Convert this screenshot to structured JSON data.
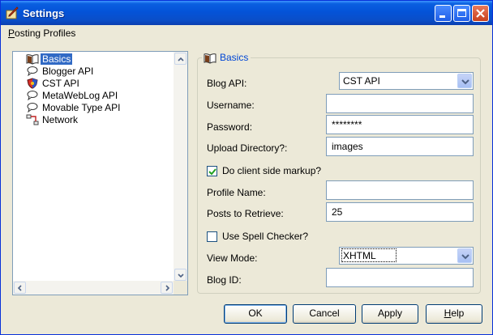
{
  "window": {
    "title": "Settings",
    "controls": {
      "minimize": "minimize",
      "maximize": "maximize",
      "close": "close"
    }
  },
  "menu": {
    "items": [
      {
        "mnemonic": "P",
        "rest": "osting Profiles"
      }
    ]
  },
  "tree": {
    "items": [
      {
        "label": "Basics",
        "icon": "book-icon",
        "selected": true
      },
      {
        "label": "Blogger API",
        "icon": "speech-bubble-icon",
        "selected": false
      },
      {
        "label": "CST API",
        "icon": "shield-icon",
        "selected": false
      },
      {
        "label": "MetaWebLog API",
        "icon": "speech-bubble-icon",
        "selected": false
      },
      {
        "label": "Movable Type API",
        "icon": "speech-bubble-icon",
        "selected": false
      },
      {
        "label": "Network",
        "icon": "network-icon",
        "selected": false
      }
    ]
  },
  "panel": {
    "title": "Basics",
    "blog_api": {
      "label": "Blog API:",
      "value": "CST API"
    },
    "username": {
      "label": "Username:",
      "value": ""
    },
    "password": {
      "label": "Password:",
      "value": "********"
    },
    "upload_dir": {
      "label": "Upload Directory?:",
      "value": "images"
    },
    "client_markup": {
      "label": "Do client side markup?",
      "checked": true
    },
    "profile_name": {
      "label": "Profile Name:",
      "value": ""
    },
    "posts_to_retrieve": {
      "label": "Posts to Retrieve:",
      "value": "25"
    },
    "spell_checker": {
      "label": "Use Spell Checker?",
      "checked": false
    },
    "view_mode": {
      "label": "View Mode:",
      "value": "XHTML"
    },
    "blog_id": {
      "label": "Blog ID:",
      "value": ""
    }
  },
  "buttons": {
    "ok": "OK",
    "cancel": "Cancel",
    "apply": "Apply",
    "help_mnemonic": "H",
    "help_rest": "elp"
  },
  "colors": {
    "title_bar": "#0453d8",
    "selection": "#316ac5",
    "group_title": "#0046d5",
    "face": "#ece9d8"
  }
}
